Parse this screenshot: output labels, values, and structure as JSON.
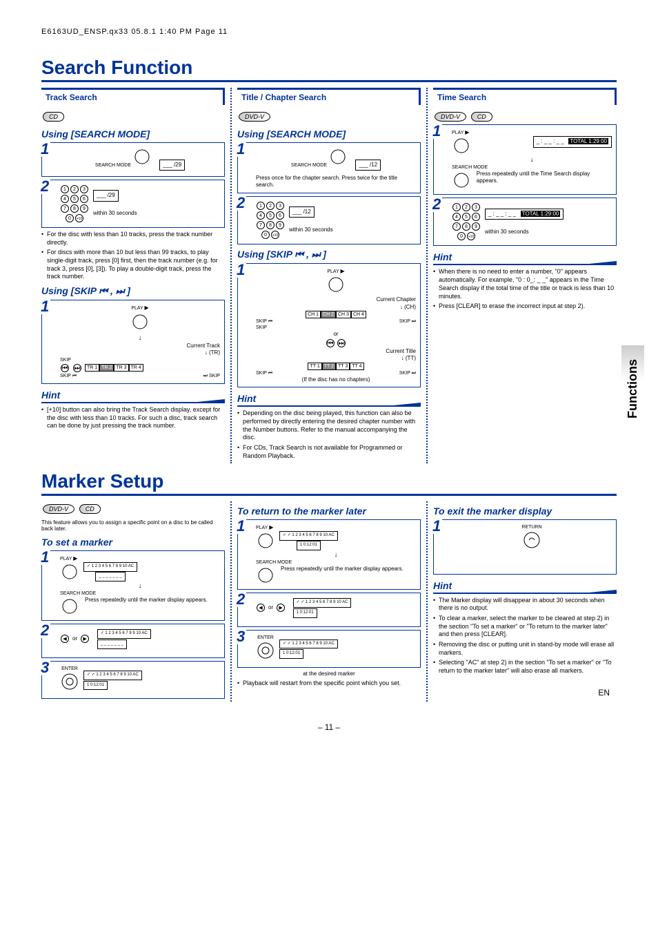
{
  "header": "E6163UD_ENSP.qx33  05.8.1  1:40 PM  Page 11",
  "section1_title": "Search Function",
  "section2_title": "Marker Setup",
  "side_tab": "Functions",
  "page_number": "– 11 –",
  "page_lang": "EN",
  "badges": {
    "cd": "CD",
    "dvdv": "DVD-V"
  },
  "buttons": {
    "search_mode": "SEARCH MODE",
    "play": "PLAY",
    "skip": "SKIP",
    "enter": "ENTER",
    "return": "RETURN"
  },
  "track": {
    "header": "Track Search",
    "using_search": "Using [SEARCH MODE]",
    "using_skip": "Using [SKIP ⏮ , ⏭ ]",
    "step1_osd": "___ /29",
    "step2_osd": "___ /29",
    "step2_note": "within 30 seconds",
    "bullets": [
      "For the disc with less than 10 tracks, press the track number directly.",
      "For discs with more than 10 but less than 99 tracks, to play single-digit track, press [0] first, then the track number (e.g. for track 3, press [0], [3]). To play a double-digit track, press the track number."
    ],
    "skip_current": "Current Track",
    "skip_tr": "(TR)",
    "skip_prev": "SKIP ⏮",
    "skip_next": "⏭ SKIP",
    "tracks": [
      "TR 1",
      "TR 2",
      "TR 3",
      "TR 4"
    ],
    "hint_header": "Hint",
    "hint_items": [
      "[+10] button can also bring the Track Search display, except for the disc with less than 10 tracks. For such a disc, track search can be done by just pressing the track number."
    ]
  },
  "title_chapter": {
    "header": "Title / Chapter Search",
    "using_search": "Using [SEARCH MODE]",
    "using_skip": "Using [SKIP ⏮ , ⏭ ]",
    "step1_osd": "___ /12",
    "step1_note": "Press once for the chapter search. Press twice for the title search.",
    "step2_osd": "___ /12",
    "step2_note": "within 30 seconds",
    "skip_play": "PLAY",
    "skip_current_ch": "Current Chapter",
    "skip_ch": "(CH)",
    "chapters": [
      "CH 1",
      "CH 2",
      "CH 3",
      "CH 4"
    ],
    "skip_ch_prev": "SKIP ⏮",
    "skip_ch_next": "SKIP ⏭",
    "or": "or",
    "skip_current_tt": "Current Title",
    "skip_tt": "(TT)",
    "titles": [
      "TT 1",
      "TT 2",
      "TT 3",
      "TT 4"
    ],
    "if_no_chapters": "(If the disc has no chapters)",
    "hint_header": "Hint",
    "hint_items": [
      "Depending on the disc being played, this function can also be performed by directly entering the desired chapter number with the Number buttons. Refer to the manual accompanying the disc.",
      "For CDs, Track Search is not available for Programmed or Random Playback."
    ]
  },
  "time_search": {
    "header": "Time Search",
    "step1_osd": "TOTAL 1:29:00",
    "step1_note": "Press repeatedly until the Time Search display appears.",
    "step2_osd": "TOTAL 1:29:00",
    "step2_note": "within 30 seconds",
    "hint_header": "Hint",
    "hint_items": [
      "When there is no need to enter a number, \"0\" appears automatically. For example, \"0 : 0_: _ _\" appears in the Time Search display if the total time of the title or track is less than 10 minutes.",
      "Press [CLEAR] to erase the incorrect input at step 2)."
    ]
  },
  "marker": {
    "intro": "This feature allows you to assign a specific point on a disc to be called back later.",
    "to_set": "To set a marker",
    "to_return": "To return to the marker later",
    "to_exit": "To exit the marker display",
    "set_step1_note": "Press repeatedly until the marker display appears.",
    "set_osd1": "1 2 3 4 5 6 7 8 9 10 AC",
    "set_osd2_line": "_ _ _ _ _ _ _",
    "set_step2_or": "or",
    "set_osd3_tt": "1  0:12:01",
    "return_step1_note": "Press repeatedly until the marker display appears.",
    "return_step2_or": "or",
    "return_osd_tt": "1  0:12:01",
    "return_step3_note": "at the desired marker",
    "return_step3_sub": "Playback will restart from the specific point which you set.",
    "exit_hint_header": "Hint",
    "exit_hint_items": [
      "The Marker display will disappear in about 30 seconds when there is no output.",
      "To clear a marker, select the marker to be cleared at step 2) in the section \"To set a marker\" or \"To return to the marker later\" and then press [CLEAR].",
      "Removing the disc or putting unit in stand-by mode will erase all markers.",
      "Selecting \"AC\" at step 2) in the section \"To set a marker\" or \"To return to the marker later\" will also erase all markers."
    ]
  }
}
